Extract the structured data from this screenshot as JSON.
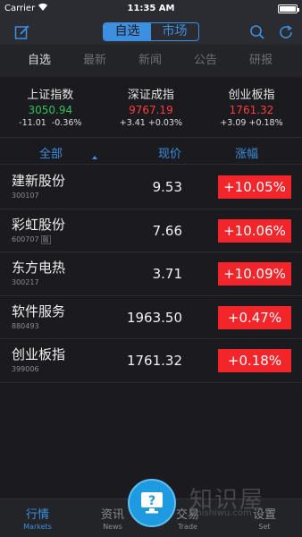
{
  "status_bar": {
    "carrier": "Carrier",
    "time": "11:35 AM"
  },
  "nav": {
    "segments": [
      "自选",
      "市场"
    ],
    "active_segment": 0
  },
  "sub_tabs": [
    "自选",
    "最新",
    "新闻",
    "公告",
    "研报"
  ],
  "indices": [
    {
      "name": "上证指数",
      "value": "3050.94",
      "change": "-11.01",
      "percent": "-0.36%",
      "color": "#2ec25b"
    },
    {
      "name": "深证成指",
      "value": "9767.19",
      "change": "+3.41",
      "percent": "+0.03%",
      "color": "#ff3b3b"
    },
    {
      "name": "创业板指",
      "value": "1761.32",
      "change": "+3.09",
      "percent": "+0.18%",
      "color": "#ff3b3b"
    }
  ],
  "table": {
    "headers": {
      "name": "全部",
      "price": "现价",
      "change": "涨幅"
    },
    "rows": [
      {
        "name": "建新股份",
        "code": "300107",
        "tag": "",
        "price": "9.53",
        "change": "+10.05%"
      },
      {
        "name": "彩虹股份",
        "code": "600707",
        "tag": "融",
        "price": "7.66",
        "change": "+10.06%"
      },
      {
        "name": "东方电热",
        "code": "300217",
        "tag": "",
        "price": "3.71",
        "change": "+10.09%"
      },
      {
        "name": "软件服务",
        "code": "880493",
        "tag": "",
        "price": "1963.50",
        "change": "+0.47%"
      },
      {
        "name": "创业板指",
        "code": "399006",
        "tag": "",
        "price": "1761.32",
        "change": "+0.18%"
      }
    ]
  },
  "tab_bar": [
    {
      "label": "行情",
      "sub": "Markets",
      "active": true
    },
    {
      "label": "资讯",
      "sub": "News",
      "active": false
    },
    {
      "label": "交易",
      "sub": "Trade",
      "active": false
    },
    {
      "label": "设置",
      "sub": "Set",
      "active": false
    }
  ],
  "watermark": {
    "text": "知识屋",
    "url": "zhishiwu.com"
  },
  "colors": {
    "accent": "#3d8fe0",
    "up": "#ff3b3b",
    "down": "#2ec25b",
    "badge": "#f2262a"
  }
}
